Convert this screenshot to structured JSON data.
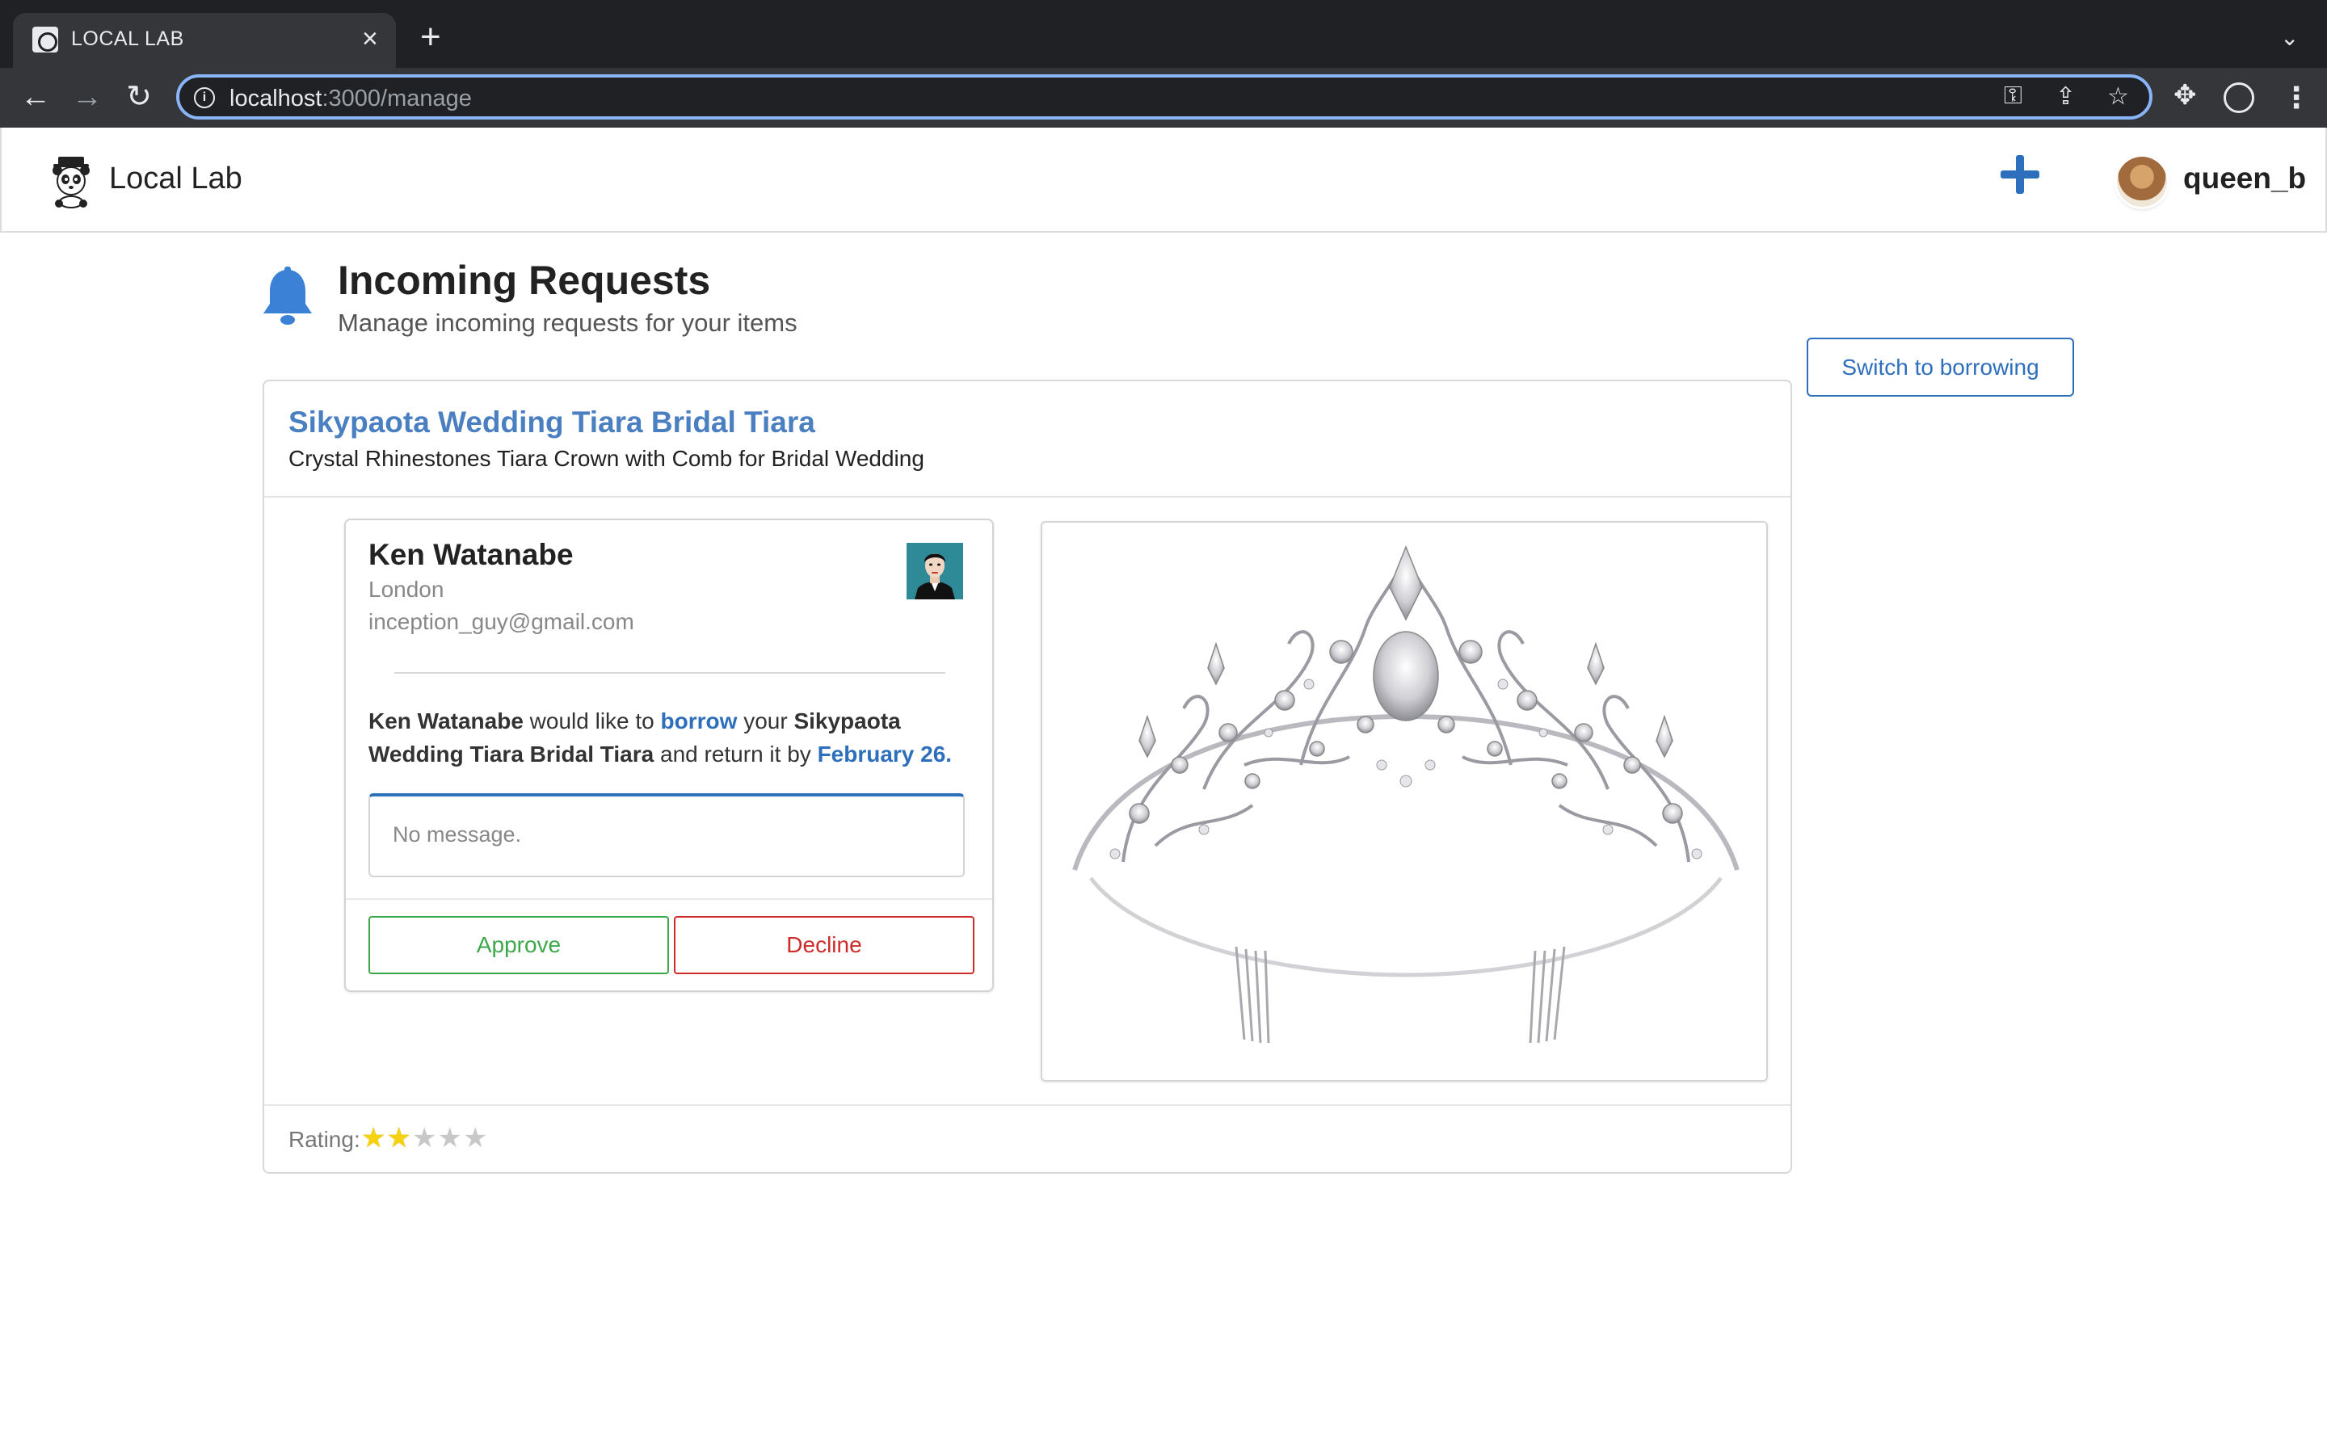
{
  "browser": {
    "tab_title": "LOCAL LAB",
    "url_host": "localhost",
    "url_path": ":3000/manage"
  },
  "app": {
    "brand": "Local Lab",
    "username": "queen_b"
  },
  "page": {
    "title": "Incoming Requests",
    "subtitle": "Manage incoming requests for your items",
    "switch_label": "Switch to borrowing"
  },
  "item": {
    "title": "Sikypaota Wedding Tiara Bridal Tiara",
    "description": "Crystal Rhinestones Tiara Crown with Comb for Bridal Wedding",
    "rating_label": "Rating:",
    "rating": 2,
    "rating_max": 5
  },
  "request": {
    "name": "Ken Watanabe",
    "location": "London",
    "email": "inception_guy@gmail.com",
    "text_name": "Ken Watanabe",
    "text_part1": " would like to ",
    "text_action": "borrow",
    "text_part2": " your ",
    "text_item": "Sikypaota Wedding Tiara Bridal Tiara",
    "text_part3": " and return it by ",
    "text_date": "February 26.",
    "message": "No message.",
    "approve_label": "Approve",
    "decline_label": "Decline"
  },
  "colors": {
    "accent": "#2d6fbd",
    "title_link": "#4a7fc1",
    "approve": "#3da84a",
    "decline": "#cf2b2b",
    "star_on": "#f5d20f",
    "star_off": "#c8c8c8"
  },
  "icons": {
    "bell": "bell-icon",
    "add": "plus-icon",
    "star": "star-icon"
  }
}
